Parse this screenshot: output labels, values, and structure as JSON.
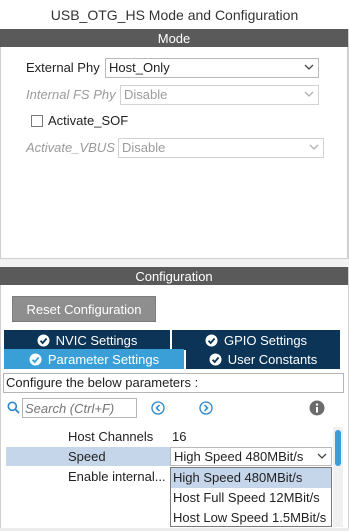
{
  "window": {
    "title": "USB_OTG_HS Mode and Configuration"
  },
  "mode": {
    "header": "Mode",
    "external_phy": {
      "label": "External Phy",
      "value": "Host_Only"
    },
    "internal_fs_phy": {
      "label": "Internal FS Phy",
      "value": "Disable"
    },
    "activate_sof": {
      "label": "Activate_SOF",
      "checked": false
    },
    "activate_vbus": {
      "label": "Activate_VBUS",
      "value": "Disable"
    }
  },
  "configuration": {
    "header": "Configuration",
    "reset_label": "Reset Configuration",
    "tabs": [
      {
        "label": "NVIC Settings",
        "icon": "check-circle-icon",
        "active": false
      },
      {
        "label": "GPIO Settings",
        "icon": "check-circle-icon",
        "active": false
      },
      {
        "label": "Parameter Settings",
        "icon": "check-circle-icon",
        "active": true
      },
      {
        "label": "User Constants",
        "icon": "check-circle-icon",
        "active": false
      }
    ],
    "description": "Configure the below parameters :",
    "search": {
      "placeholder": "Search (Ctrl+F)"
    },
    "params": [
      {
        "label": "Host Channels",
        "value": "16"
      },
      {
        "label": "Speed",
        "value": "High Speed 480MBit/s"
      },
      {
        "label": "Enable internal...",
        "value": ""
      }
    ],
    "speed_options": [
      "High Speed 480MBit/s",
      "Host Full Speed 12MBit/s",
      "Host Low Speed 1.5MBit/s"
    ]
  },
  "colors": {
    "header_bg": "#5a5a5a",
    "tab_dark": "#0b3457",
    "tab_active": "#3a9fd6",
    "selection": "#c5d6ea",
    "button_bg": "#8e8e8e"
  }
}
